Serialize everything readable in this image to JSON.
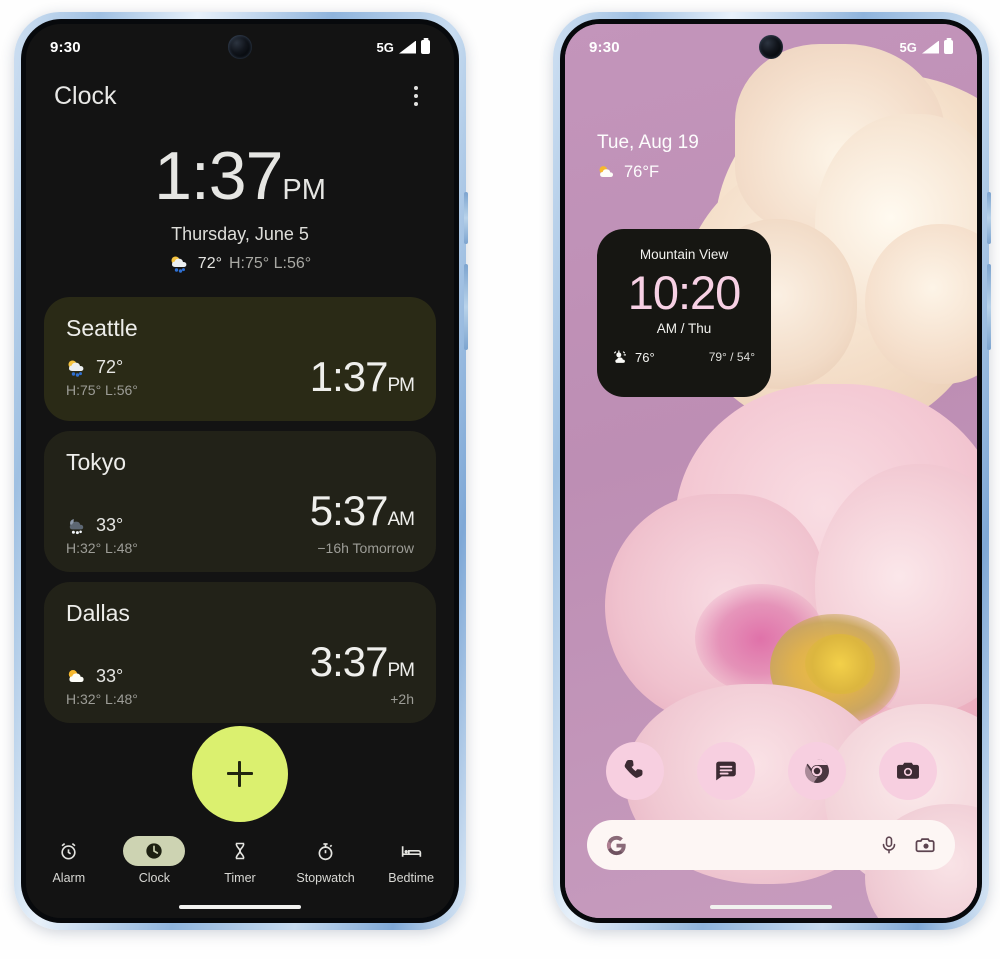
{
  "left_phone": {
    "status_bar": {
      "time": "9:30",
      "network": "5G",
      "signal_icon": "signal-bars-icon",
      "battery_icon": "battery-full-icon"
    },
    "app": {
      "title": "Clock",
      "overflow_icon": "kebab-menu-icon",
      "main_clock": {
        "time": "1:37",
        "ampm": "PM",
        "date": "Thursday, June 5",
        "weather_icon": "rain-cloud-icon",
        "temp": "72°",
        "high_low": "H:75°  L:56°"
      },
      "cities": [
        {
          "name": "Seattle",
          "weather_icon": "rain-cloud-icon",
          "temp": "72°",
          "high_low": "H:75° L:56°",
          "time": "1:37",
          "ampm": "PM",
          "offset": ""
        },
        {
          "name": "Tokyo",
          "weather_icon": "night-snow-icon",
          "temp": "33°",
          "high_low": "H:32° L:48°",
          "time": "5:37",
          "ampm": "AM",
          "offset": "−16h  Tomorrow"
        },
        {
          "name": "Dallas",
          "weather_icon": "sun-cloud-icon",
          "temp": "33°",
          "high_low": "H:32° L:48°",
          "time": "3:37",
          "ampm": "PM",
          "offset": "+2h"
        }
      ],
      "fab": {
        "icon": "plus-icon",
        "color": "#dbf06f"
      },
      "nav": [
        {
          "label": "Alarm",
          "icon": "alarm-clock-icon",
          "active": false
        },
        {
          "label": "Clock",
          "icon": "clock-icon",
          "active": true
        },
        {
          "label": "Timer",
          "icon": "hourglass-icon",
          "active": false
        },
        {
          "label": "Stopwatch",
          "icon": "stopwatch-icon",
          "active": false
        },
        {
          "label": "Bedtime",
          "icon": "bed-icon",
          "active": false
        }
      ]
    }
  },
  "right_phone": {
    "status_bar": {
      "time": "9:30",
      "network": "5G",
      "signal_icon": "signal-bars-icon",
      "battery_icon": "battery-full-icon"
    },
    "home": {
      "date": "Tue, Aug 19",
      "weather_icon": "sun-cloud-icon",
      "weather_temp": "76°F",
      "clock_widget": {
        "city": "Mountain View",
        "time": "10:20",
        "sub": "AM / Thu",
        "weather_icon": "sun-cloud-icon",
        "temp": "76°",
        "high_low": "79° / 54°",
        "accent_color": "#f7d0e4"
      },
      "dock": [
        {
          "name": "Phone",
          "icon": "phone-icon"
        },
        {
          "name": "Messages",
          "icon": "messages-icon"
        },
        {
          "name": "Chrome",
          "icon": "chrome-icon"
        },
        {
          "name": "Camera",
          "icon": "camera-icon"
        }
      ],
      "search": {
        "logo_icon": "google-g-icon",
        "mic_icon": "microphone-icon",
        "lens_icon": "google-lens-icon",
        "placeholder": ""
      }
    }
  }
}
